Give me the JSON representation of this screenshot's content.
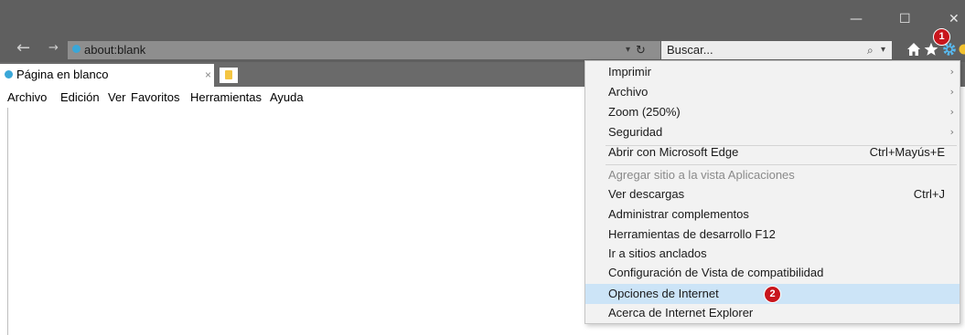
{
  "window": {
    "minimize_glyph": "—",
    "maximize_glyph": "☐",
    "close_glyph": "✕"
  },
  "nav": {
    "back_glyph": "←",
    "forward_glyph": "→",
    "address": "about:blank",
    "address_dropdown_glyph": "▾",
    "refresh_glyph": "↻",
    "search_placeholder": "Buscar...",
    "search_glyph": "⌕",
    "search_dropdown_glyph": "▾",
    "icons": [
      "home-icon",
      "favorites-star-icon",
      "tools-gear-icon"
    ]
  },
  "annotations": {
    "step1": "1",
    "step2": "2"
  },
  "tab": {
    "label": "Página en blanco",
    "close_glyph": "×"
  },
  "menubar": [
    "Archivo",
    "Edición",
    "Ver",
    "Favoritos",
    "Herramientas",
    "Ayuda"
  ],
  "menu": {
    "items": [
      {
        "label": "Imprimir",
        "submenu": true,
        "arrow": "›"
      },
      {
        "label": "Archivo",
        "submenu": true,
        "arrow": "›"
      },
      {
        "label": "Zoom (250%)",
        "submenu": true,
        "arrow": "›"
      },
      {
        "label": "Seguridad",
        "submenu": true,
        "arrow": "›"
      },
      {
        "label": "Abrir con Microsoft Edge",
        "shortcut": "Ctrl+Mayús+E"
      },
      {
        "label": "Agregar sitio a la vista Aplicaciones",
        "disabled": true
      },
      {
        "label": "Ver descargas",
        "shortcut": "Ctrl+J"
      },
      {
        "label": "Administrar complementos"
      },
      {
        "label": "Herramientas de desarrollo F12"
      },
      {
        "label": "Ir a sitios anclados"
      },
      {
        "label": "Configuración de Vista de compatibilidad"
      },
      {
        "label": "Opciones de Internet",
        "highlighted": true
      },
      {
        "label": "Acerca de Internet Explorer"
      }
    ]
  },
  "colors": {
    "titlebar": "#5f5f5f",
    "menu_highlight": "#cce4f7",
    "badge": "#c8161d"
  }
}
